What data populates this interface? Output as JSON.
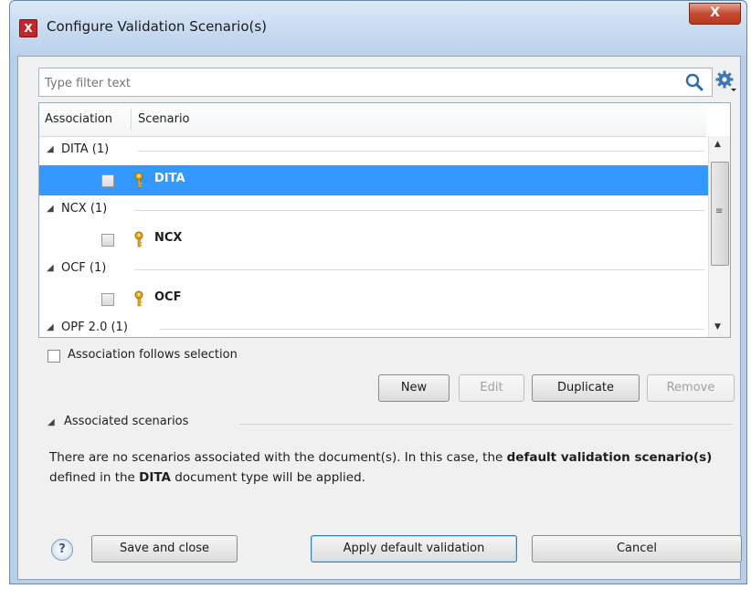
{
  "window": {
    "title": "Configure Validation Scenario(s)",
    "app_icon_letter": "X",
    "close_label": "X"
  },
  "filter": {
    "placeholder": "Type filter text"
  },
  "table": {
    "columns": [
      "Association",
      "Scenario"
    ],
    "groups": [
      {
        "label": "DITA (1)",
        "item": "DITA",
        "selected": true,
        "checked": false
      },
      {
        "label": "NCX (1)",
        "item": "NCX",
        "selected": false,
        "checked": false
      },
      {
        "label": "OCF (1)",
        "item": "OCF",
        "selected": false,
        "checked": false
      },
      {
        "label": "OPF 2.0 (1)",
        "item": null,
        "selected": false,
        "checked": false
      }
    ]
  },
  "association_follows_selection": {
    "label": "Association follows selection",
    "checked": false
  },
  "buttons": {
    "new": "New",
    "edit": "Edit",
    "duplicate": "Duplicate",
    "remove": "Remove",
    "save_and_close": "Save and close",
    "apply_default": "Apply default validation",
    "cancel": "Cancel"
  },
  "associated_section": {
    "title": "Associated scenarios",
    "message_part1": "There are no scenarios associated with the document(s). In this case, the ",
    "message_bold1": "default validation scenario(s)",
    "message_part2": " defined in the ",
    "message_bold2": "DITA",
    "message_part3": " document type will be applied."
  },
  "help": {
    "label": "?"
  },
  "colors": {
    "selection": "#3399ff",
    "accent_icon": "#e6a817",
    "titlebar": "#c5d9f0"
  },
  "icons": {
    "search": "search-icon",
    "settings": "gear-icon",
    "scenario": "key-icon"
  }
}
